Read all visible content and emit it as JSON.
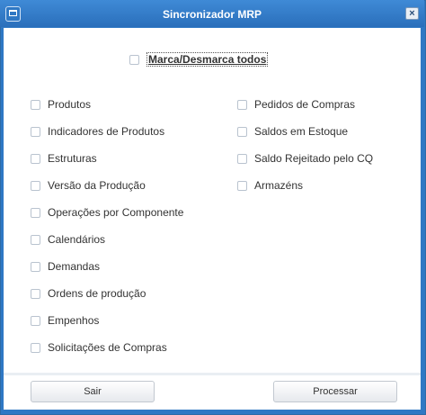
{
  "window": {
    "title": "Sincronizador MRP",
    "close_label": "×"
  },
  "toggle_all": {
    "label": "Marca/Desmarca todos",
    "checked": false
  },
  "left_column": [
    {
      "label": "Produtos",
      "checked": false
    },
    {
      "label": "Indicadores de Produtos",
      "checked": false
    },
    {
      "label": "Estruturas",
      "checked": false
    },
    {
      "label": "Versão da Produção",
      "checked": false
    },
    {
      "label": "Operações por Componente",
      "checked": false
    },
    {
      "label": "Calendários",
      "checked": false
    },
    {
      "label": "Demandas",
      "checked": false
    },
    {
      "label": "Ordens de produção",
      "checked": false
    },
    {
      "label": "Empenhos",
      "checked": false
    },
    {
      "label": "Solicitações de Compras",
      "checked": false
    }
  ],
  "right_column": [
    {
      "label": "Pedidos de Compras",
      "checked": false
    },
    {
      "label": "Saldos em Estoque",
      "checked": false
    },
    {
      "label": "Saldo Rejeitado pelo CQ",
      "checked": false
    },
    {
      "label": "Armazéns",
      "checked": false
    }
  ],
  "footer": {
    "exit_label": "Sair",
    "process_label": "Processar"
  }
}
